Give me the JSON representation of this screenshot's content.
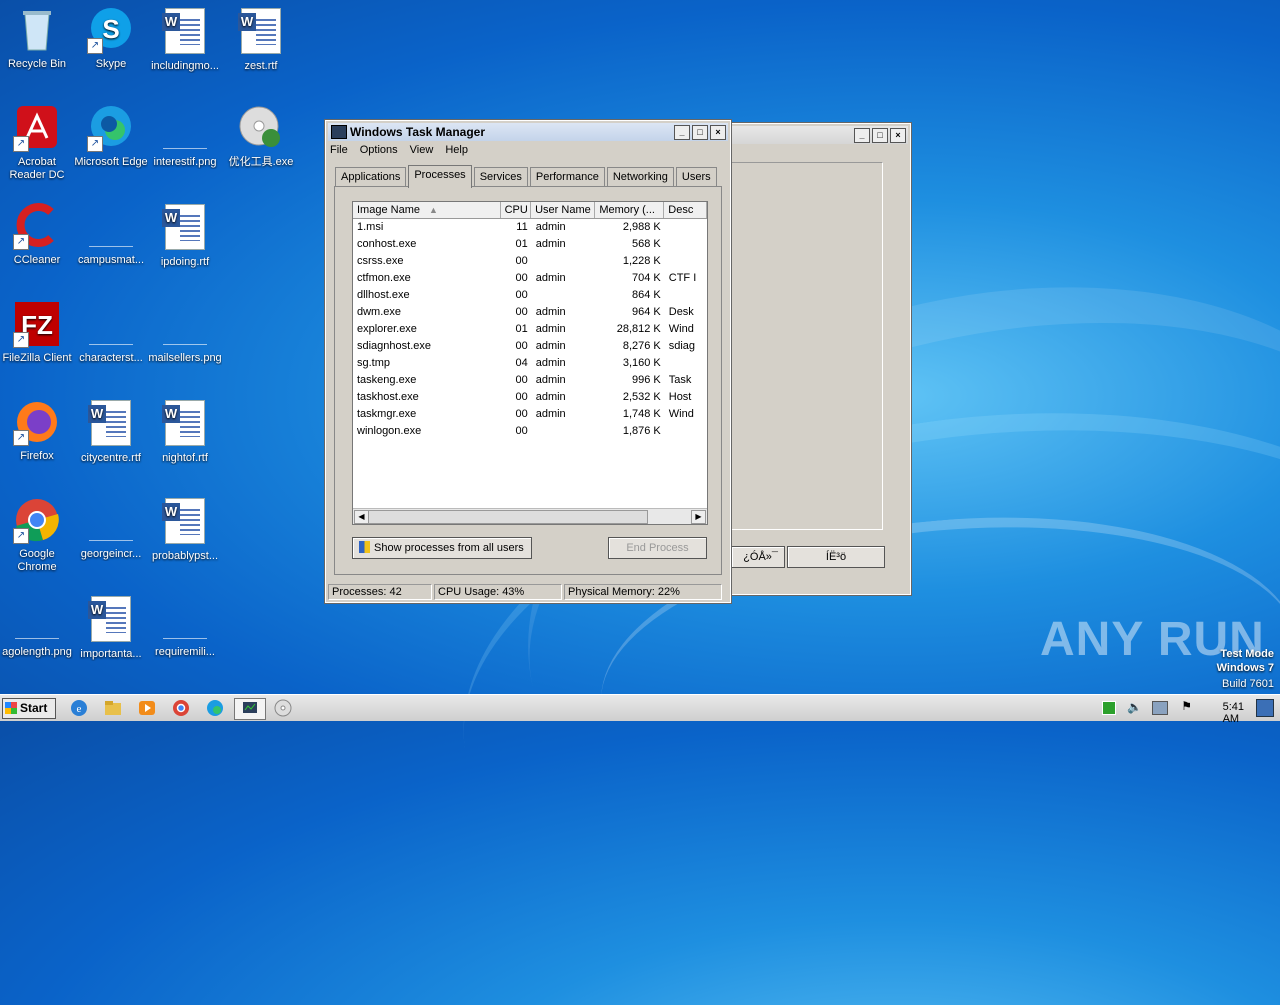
{
  "desktop": {
    "icons": [
      {
        "label": "Recycle Bin"
      },
      {
        "label": "Skype"
      },
      {
        "label": "includingmo..."
      },
      {
        "label": "zest.rtf"
      },
      {
        "label": "Acrobat Reader DC"
      },
      {
        "label": "Microsoft Edge"
      },
      {
        "label": "interestif.png"
      },
      {
        "label": "优化工具.exe"
      },
      {
        "label": "CCleaner"
      },
      {
        "label": "campusmat..."
      },
      {
        "label": "ipdoing.rtf"
      },
      {
        "label": "FileZilla Client"
      },
      {
        "label": "characterst..."
      },
      {
        "label": "mailsellers.png"
      },
      {
        "label": "Firefox"
      },
      {
        "label": "citycentre.rtf"
      },
      {
        "label": "nightof.rtf"
      },
      {
        "label": "Google Chrome"
      },
      {
        "label": "georgeincr..."
      },
      {
        "label": "probablypst..."
      },
      {
        "label": "agolength.png"
      },
      {
        "label": "importanta..."
      },
      {
        "label": "requiremili..."
      }
    ]
  },
  "taskmgr": {
    "title": "Windows Task Manager",
    "menu": [
      "File",
      "Options",
      "View",
      "Help"
    ],
    "tabs": [
      "Applications",
      "Processes",
      "Services",
      "Performance",
      "Networking",
      "Users"
    ],
    "active_tab": "Processes",
    "columns": [
      "Image Name",
      "CPU",
      "User Name",
      "Memory (...",
      "Desc"
    ],
    "rows": [
      {
        "name": "1.msi",
        "cpu": "11",
        "user": "admin",
        "mem": "2,988 K",
        "desc": ""
      },
      {
        "name": "conhost.exe",
        "cpu": "01",
        "user": "admin",
        "mem": "568 K",
        "desc": ""
      },
      {
        "name": "csrss.exe",
        "cpu": "00",
        "user": "",
        "mem": "1,228 K",
        "desc": ""
      },
      {
        "name": "ctfmon.exe",
        "cpu": "00",
        "user": "admin",
        "mem": "704 K",
        "desc": "CTF I"
      },
      {
        "name": "dllhost.exe",
        "cpu": "00",
        "user": "",
        "mem": "864 K",
        "desc": ""
      },
      {
        "name": "dwm.exe",
        "cpu": "00",
        "user": "admin",
        "mem": "964 K",
        "desc": "Desk"
      },
      {
        "name": "explorer.exe",
        "cpu": "01",
        "user": "admin",
        "mem": "28,812 K",
        "desc": "Wind"
      },
      {
        "name": "sdiagnhost.exe",
        "cpu": "00",
        "user": "admin",
        "mem": "8,276 K",
        "desc": "sdiag"
      },
      {
        "name": "sg.tmp",
        "cpu": "04",
        "user": "admin",
        "mem": "3,160 K",
        "desc": ""
      },
      {
        "name": "taskeng.exe",
        "cpu": "00",
        "user": "admin",
        "mem": "996 K",
        "desc": "Task"
      },
      {
        "name": "taskhost.exe",
        "cpu": "00",
        "user": "admin",
        "mem": "2,532 K",
        "desc": "Host"
      },
      {
        "name": "taskmgr.exe",
        "cpu": "00",
        "user": "admin",
        "mem": "1,748 K",
        "desc": "Wind"
      },
      {
        "name": "winlogon.exe",
        "cpu": "00",
        "user": "",
        "mem": "1,876 K",
        "desc": ""
      }
    ],
    "show_all_label": "Show processes from all users",
    "end_process_label": "End Process",
    "status": {
      "processes": "Processes: 42",
      "cpu": "CPU Usage: 43%",
      "memory": "Physical Memory: 22%"
    }
  },
  "background_window": {
    "button1": "¿ÓÅ»¯",
    "button2": "ÍË³ö"
  },
  "watermark": {
    "brand": "ANY RUN",
    "line1": "Test Mode",
    "line2": "Windows 7",
    "line3": "Build 7601"
  },
  "taskbar": {
    "start_label": "Start",
    "time": "5:41 AM"
  }
}
